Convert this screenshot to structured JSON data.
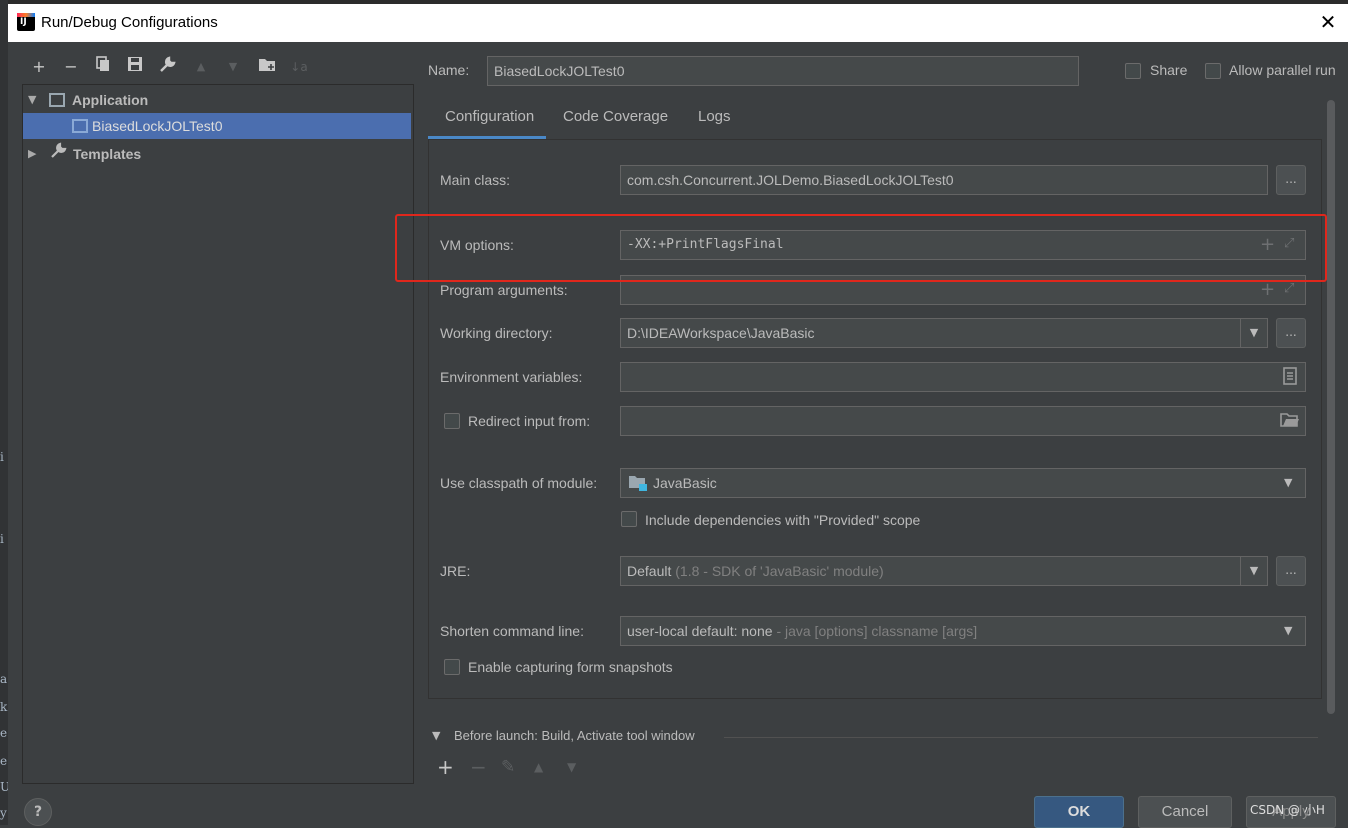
{
  "window": {
    "title": "Run/Debug Configurations",
    "close_glyph": "✕"
  },
  "behind_window": {
    "fragments": [
      "i",
      "i",
      "a",
      "k",
      "e",
      "e",
      "U",
      "y"
    ]
  },
  "toolbar": {
    "add": "+",
    "remove": "−",
    "copy": "⧉",
    "save": "🖫",
    "edit": "🔧",
    "up": "▲",
    "down": "▼",
    "folder": "📁",
    "sort": "↓a"
  },
  "tree": {
    "application_label": "Application",
    "config_label": "BiasedLockJOLTest0",
    "templates_label": "Templates",
    "expanded_glyph": "▼",
    "collapsed_glyph": "▶"
  },
  "header": {
    "name_label": "Name:",
    "name_value": "BiasedLockJOLTest0",
    "share_label": "Share",
    "allow_parallel_label": "Allow parallel run"
  },
  "tabs": [
    {
      "label": "Configuration",
      "active": true
    },
    {
      "label": "Code Coverage",
      "active": false
    },
    {
      "label": "Logs",
      "active": false
    }
  ],
  "form": {
    "main_class_label": "Main class:",
    "main_class_value": "com.csh.Concurrent.JOLDemo.BiasedLockJOLTest0",
    "vm_options_label": "VM options:",
    "vm_options_value": "-XX:+PrintFlagsFinal",
    "program_args_label": "Program arguments:",
    "program_args_value": "",
    "working_dir_label": "Working directory:",
    "working_dir_value": "D:\\IDEAWorkspace\\JavaBasic",
    "env_vars_label": "Environment variables:",
    "env_vars_value": "",
    "redirect_label": "Redirect input from:",
    "redirect_value": "",
    "classpath_label": "Use classpath of module:",
    "classpath_value": "JavaBasic",
    "include_deps_label": "Include dependencies with \"Provided\" scope",
    "jre_label": "JRE:",
    "jre_value_main": "Default",
    "jre_value_detail": "(1.8 - SDK of 'JavaBasic' module)",
    "shorten_label": "Shorten command line:",
    "shorten_value_main": "user-local default: none",
    "shorten_value_detail": "- java [options] classname [args]",
    "snapshots_label": "Enable capturing form snapshots",
    "dots": "..."
  },
  "before_launch": {
    "label": "Before launch: Build, Activate tool window",
    "add": "+",
    "remove": "−",
    "edit": "✎",
    "up": "▲",
    "down": "▼"
  },
  "buttons": {
    "ok": "OK",
    "cancel": "Cancel",
    "apply": "Apply",
    "help": "?"
  },
  "watermark": "CSDN @ 小H",
  "colors": {
    "background": "#3c3f41",
    "selection": "#4b6eaf",
    "tab_underline": "#4a88c7",
    "highlight_box": "#e0271c",
    "ok_button": "#365880"
  }
}
